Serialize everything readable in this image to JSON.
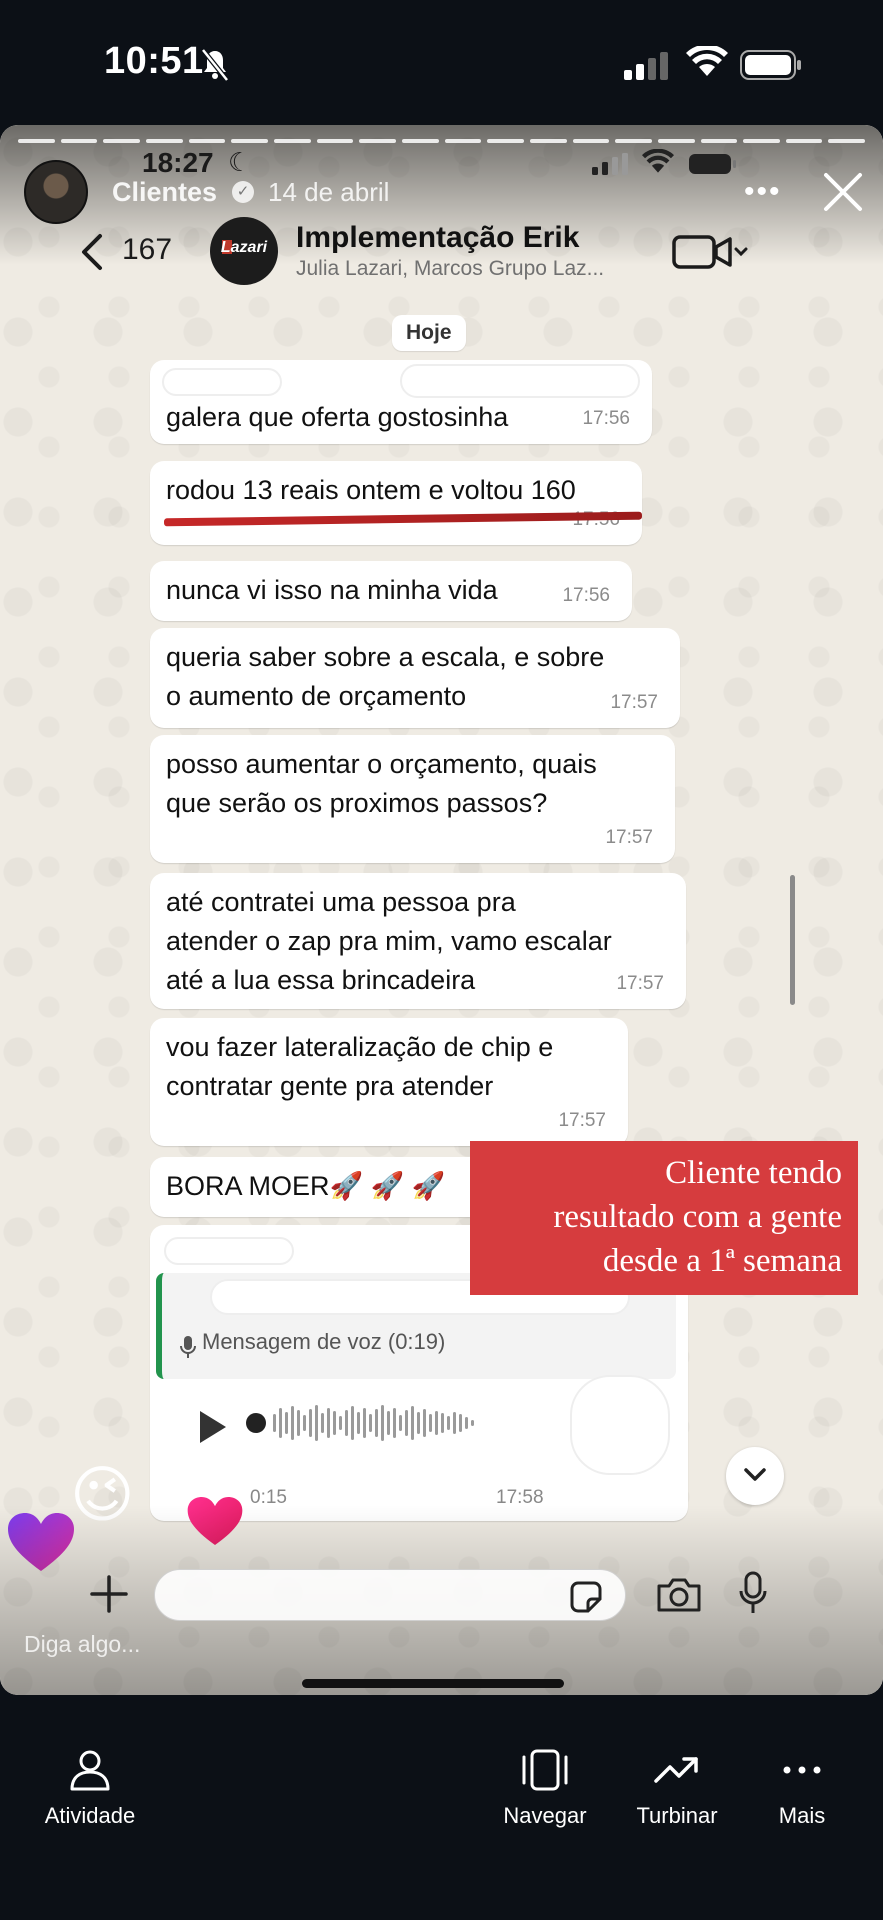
{
  "os_status": {
    "time": "10:51"
  },
  "story": {
    "user": "Clientes",
    "date": "14 de abril",
    "comment_placeholder": "Diga algo..."
  },
  "inner_status": {
    "time": "18:27"
  },
  "chat": {
    "back_count": "167",
    "group_avatar_text": "Lazari",
    "title": "Implementação Erik",
    "members": "Julia Lazari, Marcos Grupo Laz...",
    "date_pill": "Hoje",
    "messages": [
      {
        "text": "galera que oferta gostosinha",
        "time": "17:56"
      },
      {
        "text": "rodou 13 reais ontem e voltou 160",
        "time": "17:56"
      },
      {
        "text": "nunca vi isso na minha vida",
        "time": "17:56"
      },
      {
        "text": "queria saber sobre a escala, e sobre\no aumento de orçamento",
        "time": "17:57"
      },
      {
        "text": "posso aumentar o orçamento, quais\nque serão os proximos passos?",
        "time": "17:57"
      },
      {
        "text": "até contratei uma pessoa pra\natender o zap pra mim, vamo escalar\naté a lua essa brincadeira",
        "time": "17:57"
      },
      {
        "text": "vou fazer lateralização de chip e\ncontratar gente pra atender",
        "time": "17:57"
      },
      {
        "text": "BORA MOER🚀 🚀 🚀",
        "time": ""
      }
    ],
    "voice": {
      "quote_label": "Mensagem de voz (0:19)",
      "elapsed": "0:15",
      "time": "17:58"
    }
  },
  "overlay_text": "Cliente tendo\nresultado com a gente\ndesde a 1ª semana",
  "stickers": {
    "wink": "😉"
  },
  "nav": {
    "items": [
      {
        "label": "Atividade",
        "icon": "person-icon"
      },
      {
        "label": "Navegar",
        "icon": "swipe-icon"
      },
      {
        "label": "Turbinar",
        "icon": "trending-up-icon"
      },
      {
        "label": "Mais",
        "icon": "more-icon"
      }
    ]
  },
  "colors": {
    "background": "#0c1016",
    "overlay_red": "#d63c3e",
    "quote_green": "#22944d",
    "strike_red": "#c62828"
  }
}
